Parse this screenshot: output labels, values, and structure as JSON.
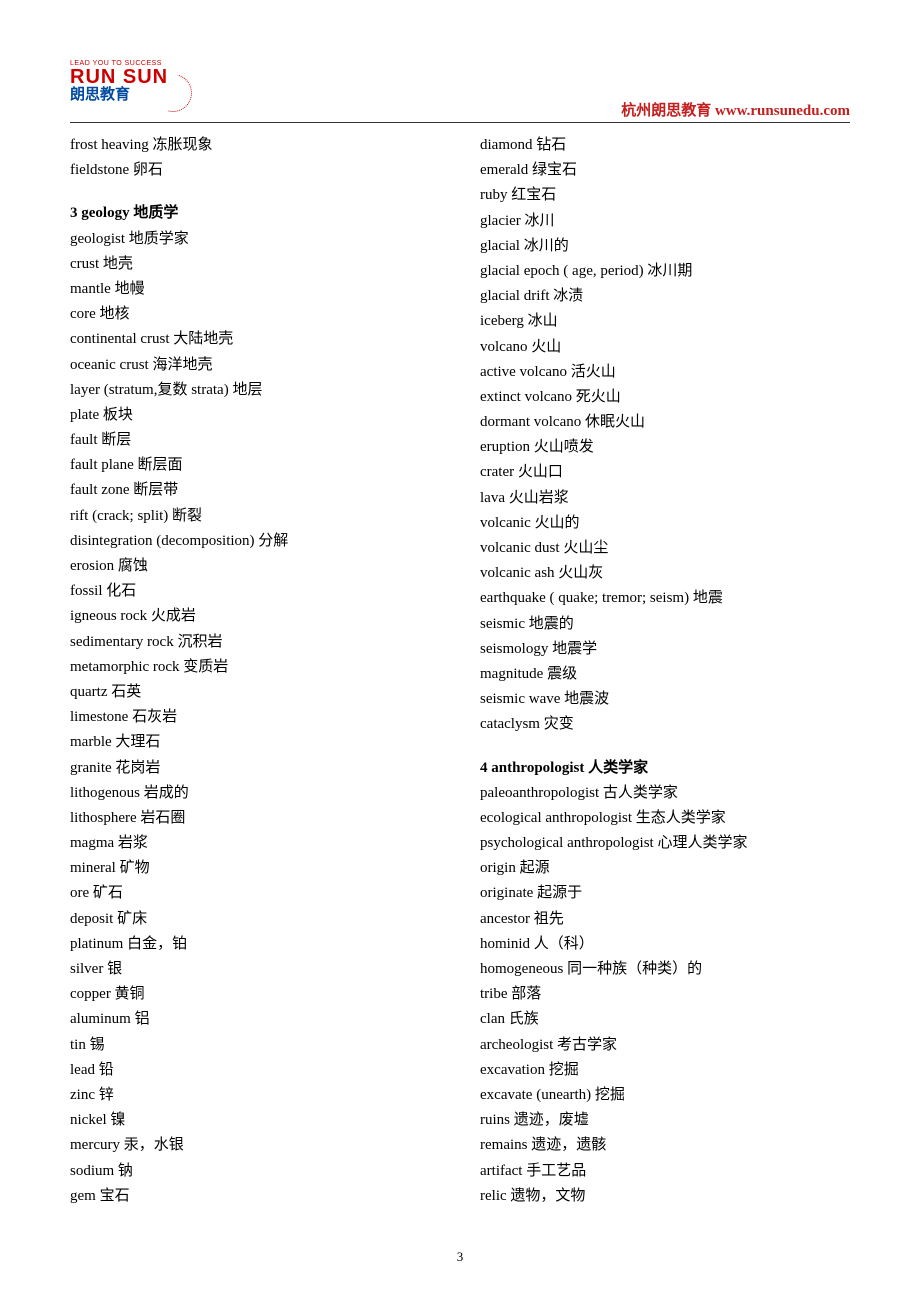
{
  "header": {
    "logo_tagline": "LEAD YOU TO SUCCESS",
    "logo_main": "RUN SUN",
    "logo_cn": "朗思教育",
    "right_cn": "杭州朗思教育",
    "right_url": "www.runsunedu.com"
  },
  "page_number": "3",
  "left_column": {
    "pre_items": [
      "frost heaving 冻胀现象",
      "fieldstone 卵石"
    ],
    "section_title": "3 geology 地质学",
    "items": [
      "geologist 地质学家",
      "crust 地壳",
      "mantle 地幔",
      "core 地核",
      "continental crust 大陆地壳",
      "oceanic crust 海洋地壳",
      "layer (stratum,复数 strata) 地层",
      "plate 板块",
      "fault 断层",
      "fault plane 断层面",
      "fault zone 断层带",
      "rift (crack; split) 断裂",
      "disintegration (decomposition) 分解",
      "erosion 腐蚀",
      "fossil 化石",
      "igneous rock 火成岩",
      "sedimentary rock 沉积岩",
      "metamorphic rock 变质岩",
      "quartz 石英",
      "limestone 石灰岩",
      "marble 大理石",
      "granite 花岗岩",
      "lithogenous 岩成的",
      "lithosphere 岩石圈",
      "magma 岩浆",
      "mineral 矿物",
      "ore 矿石",
      "deposit 矿床",
      "platinum 白金，铂",
      "silver 银",
      "copper 黄铜",
      "aluminum 铝",
      "tin 锡",
      "lead 铅",
      "zinc 锌",
      "nickel 镍",
      "mercury 汞，水银",
      "sodium 钠",
      "gem 宝石"
    ]
  },
  "right_column": {
    "pre_items": [
      "diamond 钻石",
      "emerald 绿宝石",
      "ruby 红宝石",
      "glacier 冰川",
      "glacial 冰川的",
      "glacial epoch ( age, period) 冰川期",
      "glacial drift 冰渍",
      "iceberg 冰山",
      "volcano 火山",
      "active volcano 活火山",
      "extinct volcano 死火山",
      "dormant volcano 休眠火山",
      "eruption 火山喷发",
      "crater 火山口",
      "lava 火山岩浆",
      "volcanic 火山的",
      "volcanic dust 火山尘",
      "volcanic ash 火山灰",
      "earthquake ( quake; tremor; seism) 地震",
      "seismic 地震的",
      "seismology 地震学",
      "magnitude 震级",
      "seismic wave 地震波",
      "cataclysm 灾变"
    ],
    "section_title": "4 anthropologist 人类学家",
    "items": [
      "paleoanthropologist 古人类学家",
      "ecological anthropologist 生态人类学家",
      "psychological anthropologist 心理人类学家",
      "origin 起源",
      "originate 起源于",
      "ancestor 祖先",
      "hominid 人（科）",
      "homogeneous 同一种族（种类）的",
      "tribe 部落",
      "clan 氏族",
      "archeologist 考古学家",
      "excavation 挖掘",
      "excavate (unearth) 挖掘",
      "ruins 遗迹，废墟",
      "remains 遗迹，遗骸",
      "artifact 手工艺品",
      "relic 遗物，文物"
    ]
  }
}
